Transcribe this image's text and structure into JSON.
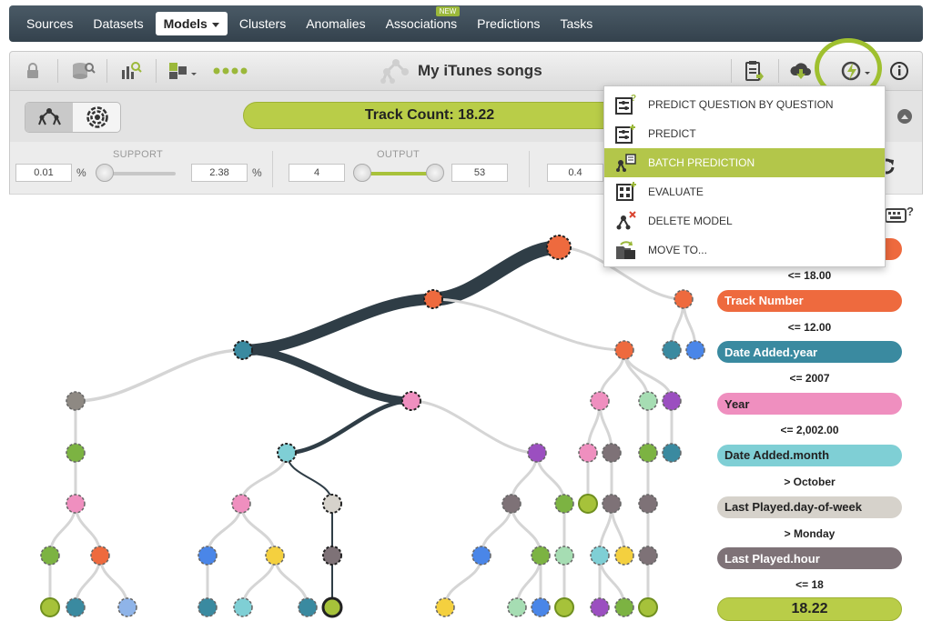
{
  "nav": {
    "items": [
      {
        "label": "Sources"
      },
      {
        "label": "Datasets"
      },
      {
        "label": "Models",
        "active": true
      },
      {
        "label": "Clusters"
      },
      {
        "label": "Anomalies"
      },
      {
        "label": "Associations",
        "badge": "NEW"
      },
      {
        "label": "Predictions"
      },
      {
        "label": "Tasks"
      }
    ]
  },
  "toolbar": {
    "title": "My iTunes songs",
    "left_icons": [
      "lock-icon",
      "dataset-icon",
      "summary-report-icon",
      "model-type-icon",
      "dots-menu-icon"
    ],
    "right_icons": [
      "clipboard-icon",
      "cloud-download-icon",
      "actions-icon",
      "info-icon"
    ]
  },
  "prediction": {
    "label": "Track Count: 18.22"
  },
  "filters": {
    "support": {
      "label": "SUPPORT",
      "min": "0.01",
      "max": "2.38",
      "unit": "%"
    },
    "output": {
      "label": "OUTPUT",
      "min": "4",
      "max": "53"
    },
    "third": {
      "min": "0.4"
    }
  },
  "dropdown": {
    "items": [
      {
        "label": "PREDICT QUESTION BY QUESTION",
        "icon": "predict-question-icon"
      },
      {
        "label": "PREDICT",
        "icon": "predict-icon"
      },
      {
        "label": "BATCH PREDICTION",
        "icon": "batch-prediction-icon",
        "selected": true
      },
      {
        "label": "EVALUATE",
        "icon": "evaluate-icon"
      },
      {
        "label": "DELETE MODEL",
        "icon": "delete-model-icon"
      },
      {
        "label": "MOVE TO...",
        "icon": "move-to-icon"
      }
    ]
  },
  "legend": {
    "path": [
      {
        "field": "",
        "color": "#ee6a3e"
      },
      {
        "condition": "<= 18.00"
      },
      {
        "field": "Track Number",
        "color": "#ee6a3e"
      },
      {
        "condition": "<= 12.00"
      },
      {
        "field": "Date Added.year",
        "color": "#3a8aa0"
      },
      {
        "condition": "<= 2007"
      },
      {
        "field": "Year",
        "color": "#ef8fbf"
      },
      {
        "condition": "<= 2,002.00"
      },
      {
        "field": "Date Added.month",
        "color": "#7fcfd5"
      },
      {
        "condition": "> October"
      },
      {
        "field": "Last Played.day-of-week",
        "color": "#d6d2cb"
      },
      {
        "condition": "> Monday"
      },
      {
        "field": "Last Played.hour",
        "color": "#7e7277"
      },
      {
        "condition": "<= 18"
      }
    ],
    "result": "18.22"
  }
}
